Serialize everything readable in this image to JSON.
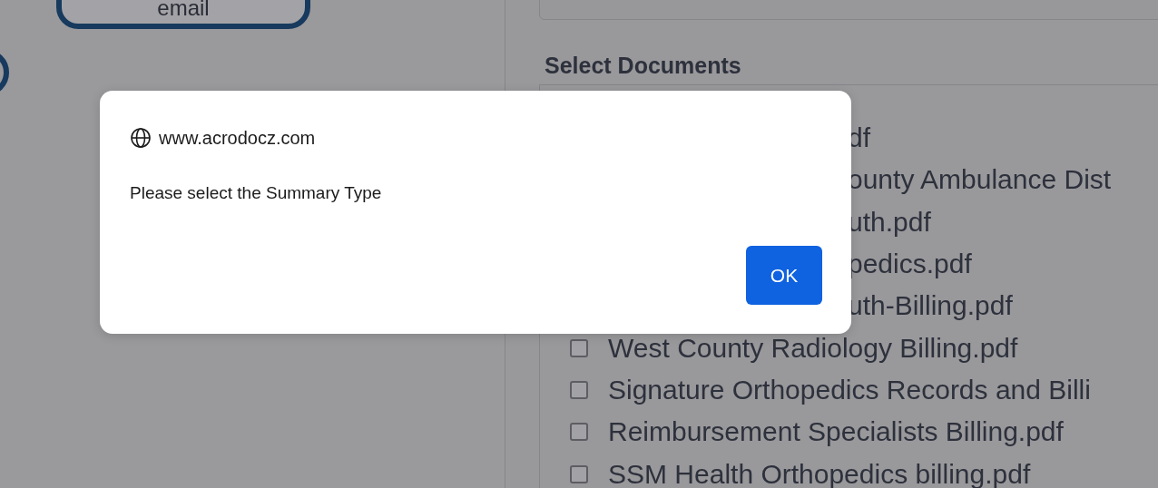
{
  "left_panel": {
    "email_button": "email"
  },
  "documents": {
    "title": "Select Documents",
    "items": [
      {
        "kind": "partial",
        "label": "df"
      },
      {
        "kind": "partial",
        "label": "ounty Ambulance Dist"
      },
      {
        "kind": "partial",
        "label": "uth.pdf"
      },
      {
        "kind": "partial",
        "label": "pedics.pdf"
      },
      {
        "kind": "partial",
        "label": "uth-Billing.pdf"
      },
      {
        "kind": "full",
        "label": "West County Radiology Billing.pdf",
        "checked": false
      },
      {
        "kind": "full",
        "label": "Signature Orthopedics Records and Billi",
        "checked": false
      },
      {
        "kind": "full",
        "label": "Reimbursement Specialists Billing.pdf",
        "checked": false
      },
      {
        "kind": "full",
        "label": "SSM Health Orthopedics billing.pdf",
        "checked": false
      }
    ]
  },
  "dialog": {
    "origin": "www.acrodocz.com",
    "message": "Please select the Summary Type",
    "button": "OK"
  }
}
